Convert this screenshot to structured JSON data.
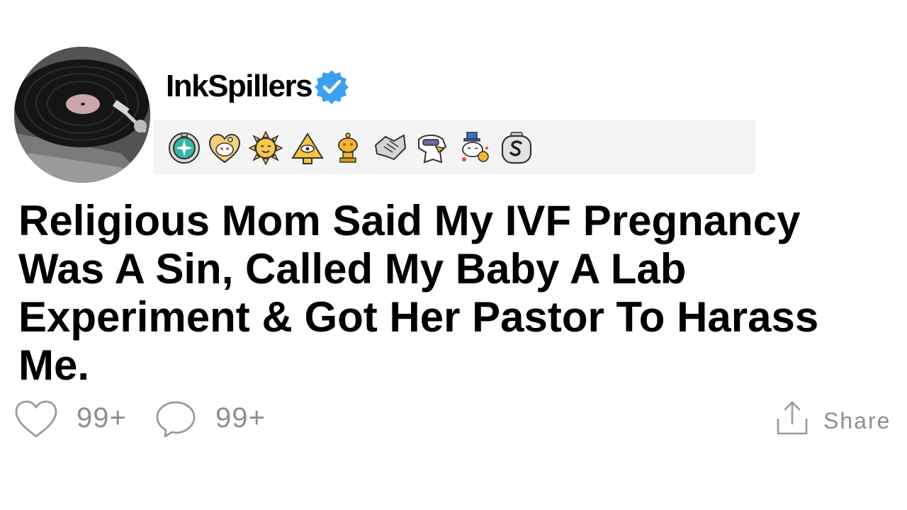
{
  "post": {
    "author": {
      "username": "InkSpillers",
      "avatar_icon": "record-player-avatar",
      "verified_icon": "verified-badge-icon",
      "verified_color": "#3aa0f0"
    },
    "awards": [
      {
        "icon": "compass-award-icon"
      },
      {
        "icon": "heart-snoo-award-icon"
      },
      {
        "icon": "sun-award-icon"
      },
      {
        "icon": "pyramid-eye-award-icon"
      },
      {
        "icon": "gold-snoo-trophy-award-icon"
      },
      {
        "icon": "handshake-award-icon"
      },
      {
        "icon": "eagle-award-icon"
      },
      {
        "icon": "snoo-uncle-sam-award-icon"
      },
      {
        "icon": "silver-s-award-icon"
      }
    ],
    "title": "Religious Mom Said My IVF Pregnancy Was A Sin, Called My Baby A Lab Experiment & Got Her Pastor To Harass Me.",
    "actions": {
      "likes_count": "99+",
      "comments_count": "99+",
      "share_label": "Share"
    }
  }
}
